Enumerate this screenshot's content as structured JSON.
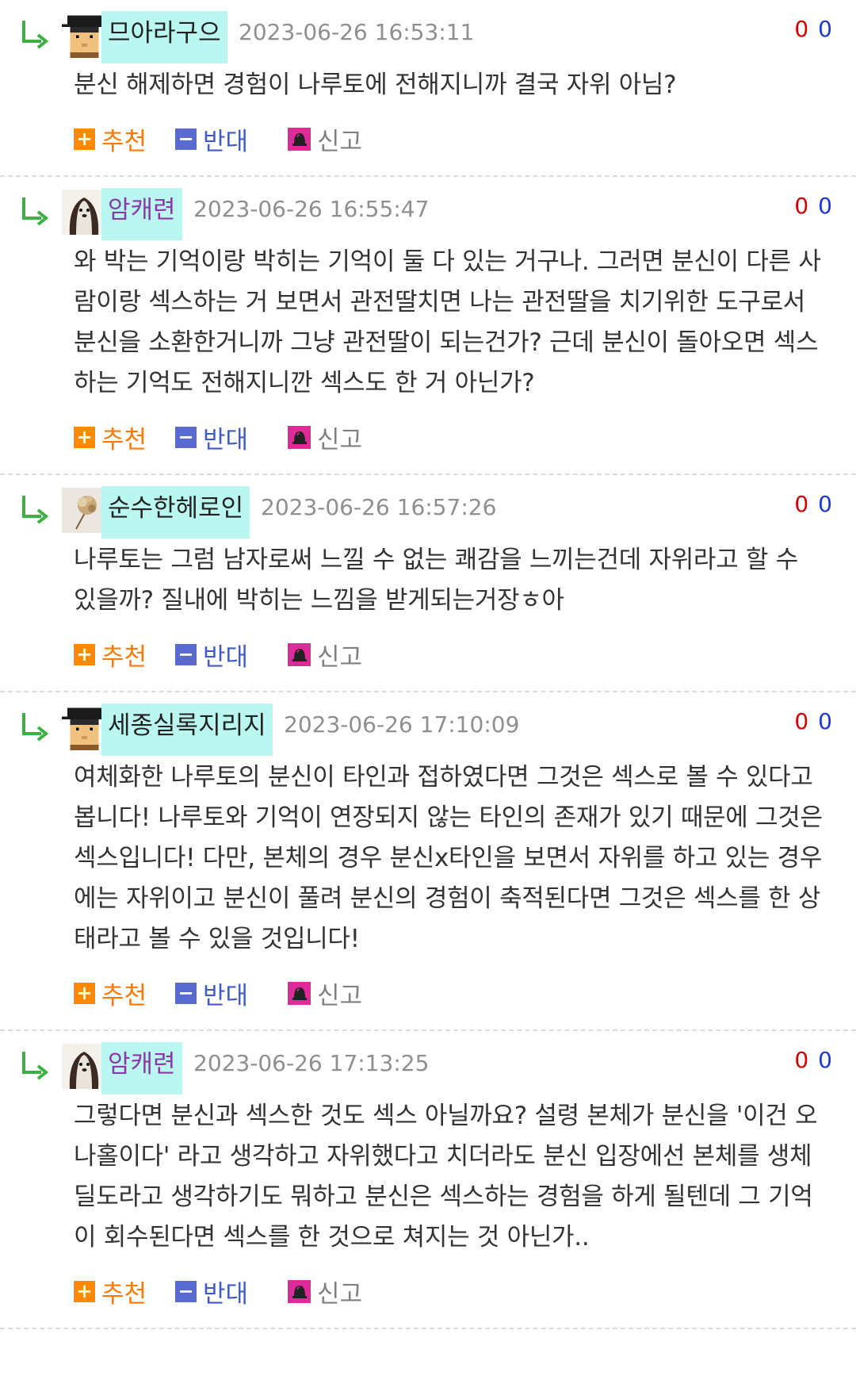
{
  "comments": [
    {
      "nickname": "므아라구으",
      "avatar": "pixel-character-avatar",
      "date": "2023-06-26 16:53:11",
      "votes_up": "0",
      "votes_down": "0",
      "text": "분신 해제하면 경험이 나루토에 전해지니까 결국 자위 아님?"
    },
    {
      "nickname": "암캐련",
      "avatar": "long-hair-dog-avatar",
      "date": "2023-06-26 16:55:47",
      "votes_up": "0",
      "votes_down": "0",
      "text": "와 박는 기억이랑 박히는 기억이 둘 다 있는 거구나. 그러면 분신이 다른 사람이랑 섹스하는 거 보면서 관전딸치면 나는 관전딸을 치기위한 도구로서 분신을 소환한거니까 그냥 관전딸이 되는건가? 근데 분신이 돌아오면 섹스하는 기억도 전해지니깐 섹스도 한 거 아닌가?"
    },
    {
      "nickname": "순수한헤로인",
      "avatar": "dried-flower-avatar",
      "date": "2023-06-26 16:57:26",
      "votes_up": "0",
      "votes_down": "0",
      "text": "나루토는 그럼 남자로써 느낄 수 없는 쾌감을 느끼는건데 자위라고 할 수 있을까? 질내에 박히는 느낌을 받게되는거장ㅎ아"
    },
    {
      "nickname": "세종실록지리지",
      "avatar": "pixel-character-avatar",
      "date": "2023-06-26 17:10:09",
      "votes_up": "0",
      "votes_down": "0",
      "text": "여체화한 나루토의 분신이 타인과 접하였다면 그것은 섹스로 볼 수 있다고 봅니다! 나루토와 기억이 연장되지 않는 타인의 존재가 있기 때문에 그것은 섹스입니다! 다만, 본체의 경우 분신x타인을 보면서 자위를 하고 있는 경우에는 자위이고 분신이 풀려 분신의 경험이 축적된다면 그것은 섹스를 한 상태라고 볼 수 있을 것입니다!"
    },
    {
      "nickname": "암캐련",
      "avatar": "long-hair-dog-avatar",
      "date": "2023-06-26 17:13:25",
      "votes_up": "0",
      "votes_down": "0",
      "text": "그렇다면 분신과 섹스한 것도 섹스 아닐까요? 설령 본체가 분신을 '이건 오나홀이다' 라고 생각하고 자위했다고 치더라도 분신 입장에선 본체를 생체딜도라고 생각하기도 뭐하고 분신은 섹스하는 경험을 하게 될텐데 그 기억이 회수된다면 섹스를 한 것으로 쳐지는 것 아닌가.."
    }
  ],
  "actions": {
    "recommend_icon": "+",
    "recommend_label": "추천",
    "oppose_icon": "−",
    "oppose_label": "반대",
    "report_label": "신고"
  },
  "colors": {
    "nickname_highlight": "#b9f7f0",
    "vote_up": "#d40000",
    "vote_down": "#1e3ad4",
    "recommend": "#ff7a00",
    "oppose": "#3f5cc8",
    "report_icon": "#e02a9a",
    "reply_arrow": "#3cb043"
  }
}
